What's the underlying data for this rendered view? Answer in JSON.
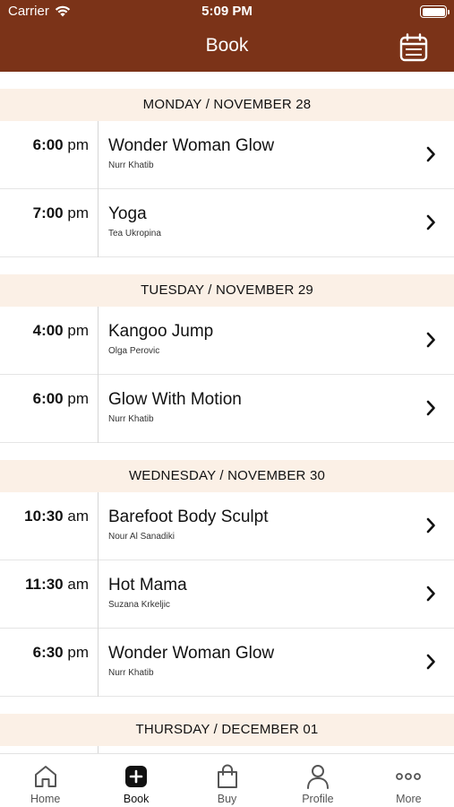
{
  "status_bar": {
    "carrier": "Carrier",
    "time": "5:09 PM"
  },
  "header": {
    "title": "Book",
    "calendar_icon": "calendar-icon"
  },
  "colors": {
    "header_bg": "#7b3318",
    "day_header_bg": "#fbf0e6",
    "active_tab": "#111111"
  },
  "days": [
    {
      "label": "MONDAY / NOVEMBER 28",
      "classes": [
        {
          "time": "6:00",
          "ampm": "pm",
          "title": "Wonder Woman Glow",
          "instructor": "Nurr Khatib"
        },
        {
          "time": "7:00",
          "ampm": "pm",
          "title": "Yoga",
          "instructor": "Tea Ukropina"
        }
      ]
    },
    {
      "label": "TUESDAY / NOVEMBER 29",
      "classes": [
        {
          "time": "4:00",
          "ampm": "pm",
          "title": "Kangoo Jump",
          "instructor": "Olga Perovic"
        },
        {
          "time": "6:00",
          "ampm": "pm",
          "title": "Glow With Motion",
          "instructor": "Nurr Khatib"
        }
      ]
    },
    {
      "label": "WEDNESDAY / NOVEMBER 30",
      "classes": [
        {
          "time": "10:30",
          "ampm": "am",
          "title": "Barefoot Body Sculpt",
          "instructor": "Nour Al Sanadiki"
        },
        {
          "time": "11:30",
          "ampm": "am",
          "title": "Hot Mama",
          "instructor": "Suzana Krkeljic"
        },
        {
          "time": "6:30",
          "ampm": "pm",
          "title": "Wonder Woman Glow",
          "instructor": "Nurr Khatib"
        }
      ]
    },
    {
      "label": "THURSDAY / DECEMBER 01",
      "classes": []
    }
  ],
  "tabbar": {
    "tabs": [
      {
        "label": "Home",
        "icon": "home-icon",
        "active": false
      },
      {
        "label": "Book",
        "icon": "plus-square-icon",
        "active": true
      },
      {
        "label": "Buy",
        "icon": "shopping-bag-icon",
        "active": false
      },
      {
        "label": "Profile",
        "icon": "person-icon",
        "active": false
      },
      {
        "label": "More",
        "icon": "more-dots-icon",
        "active": false
      }
    ]
  }
}
